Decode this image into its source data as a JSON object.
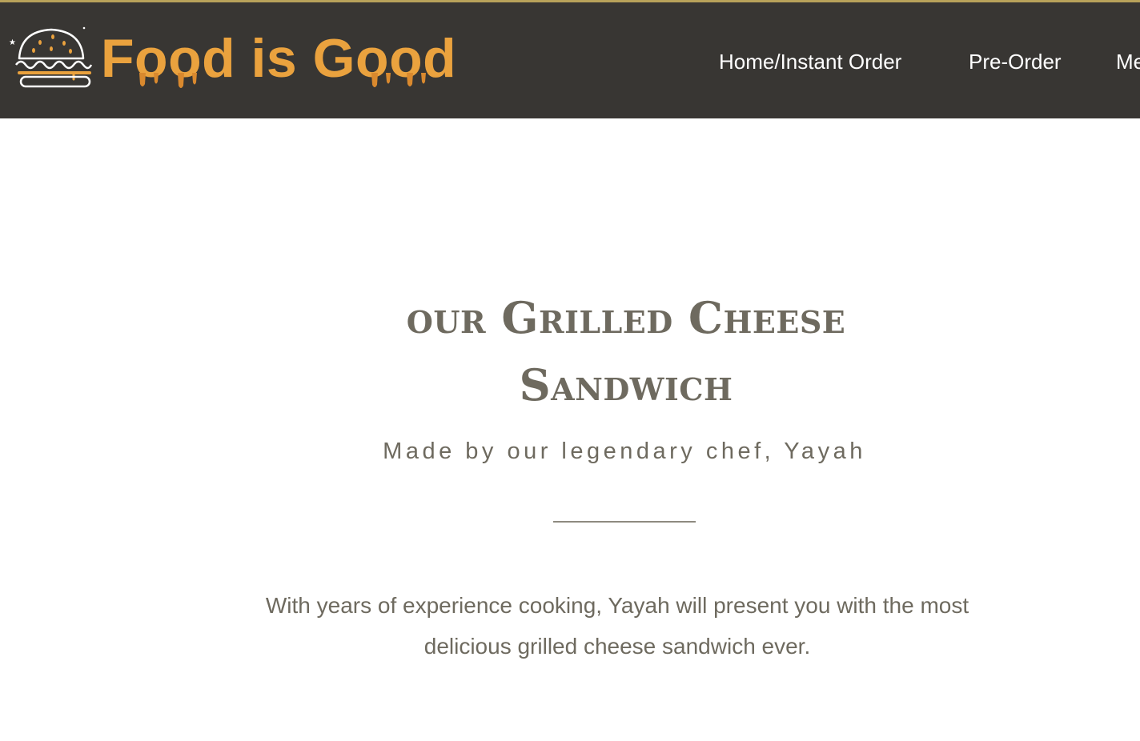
{
  "colors": {
    "header_bg": "#383633",
    "accent_line": "#b8a25a",
    "brand": "#eaa23e",
    "nav_text": "#ffffff",
    "body_text": "#6e6a5f"
  },
  "header": {
    "logo_icon": "burger-icon",
    "brand_name": "Food is Good",
    "nav": [
      {
        "label": "Home/Instant Order"
      },
      {
        "label": "Pre-Order"
      },
      {
        "label": "Me"
      }
    ]
  },
  "main": {
    "title_line1": "our Grilled Cheese",
    "title_line2": "Sandwich",
    "subtitle": "Made by our legendary chef, Yayah",
    "description": "With years of experience cooking, Yayah will present you with the most delicious grilled cheese sandwich ever."
  }
}
